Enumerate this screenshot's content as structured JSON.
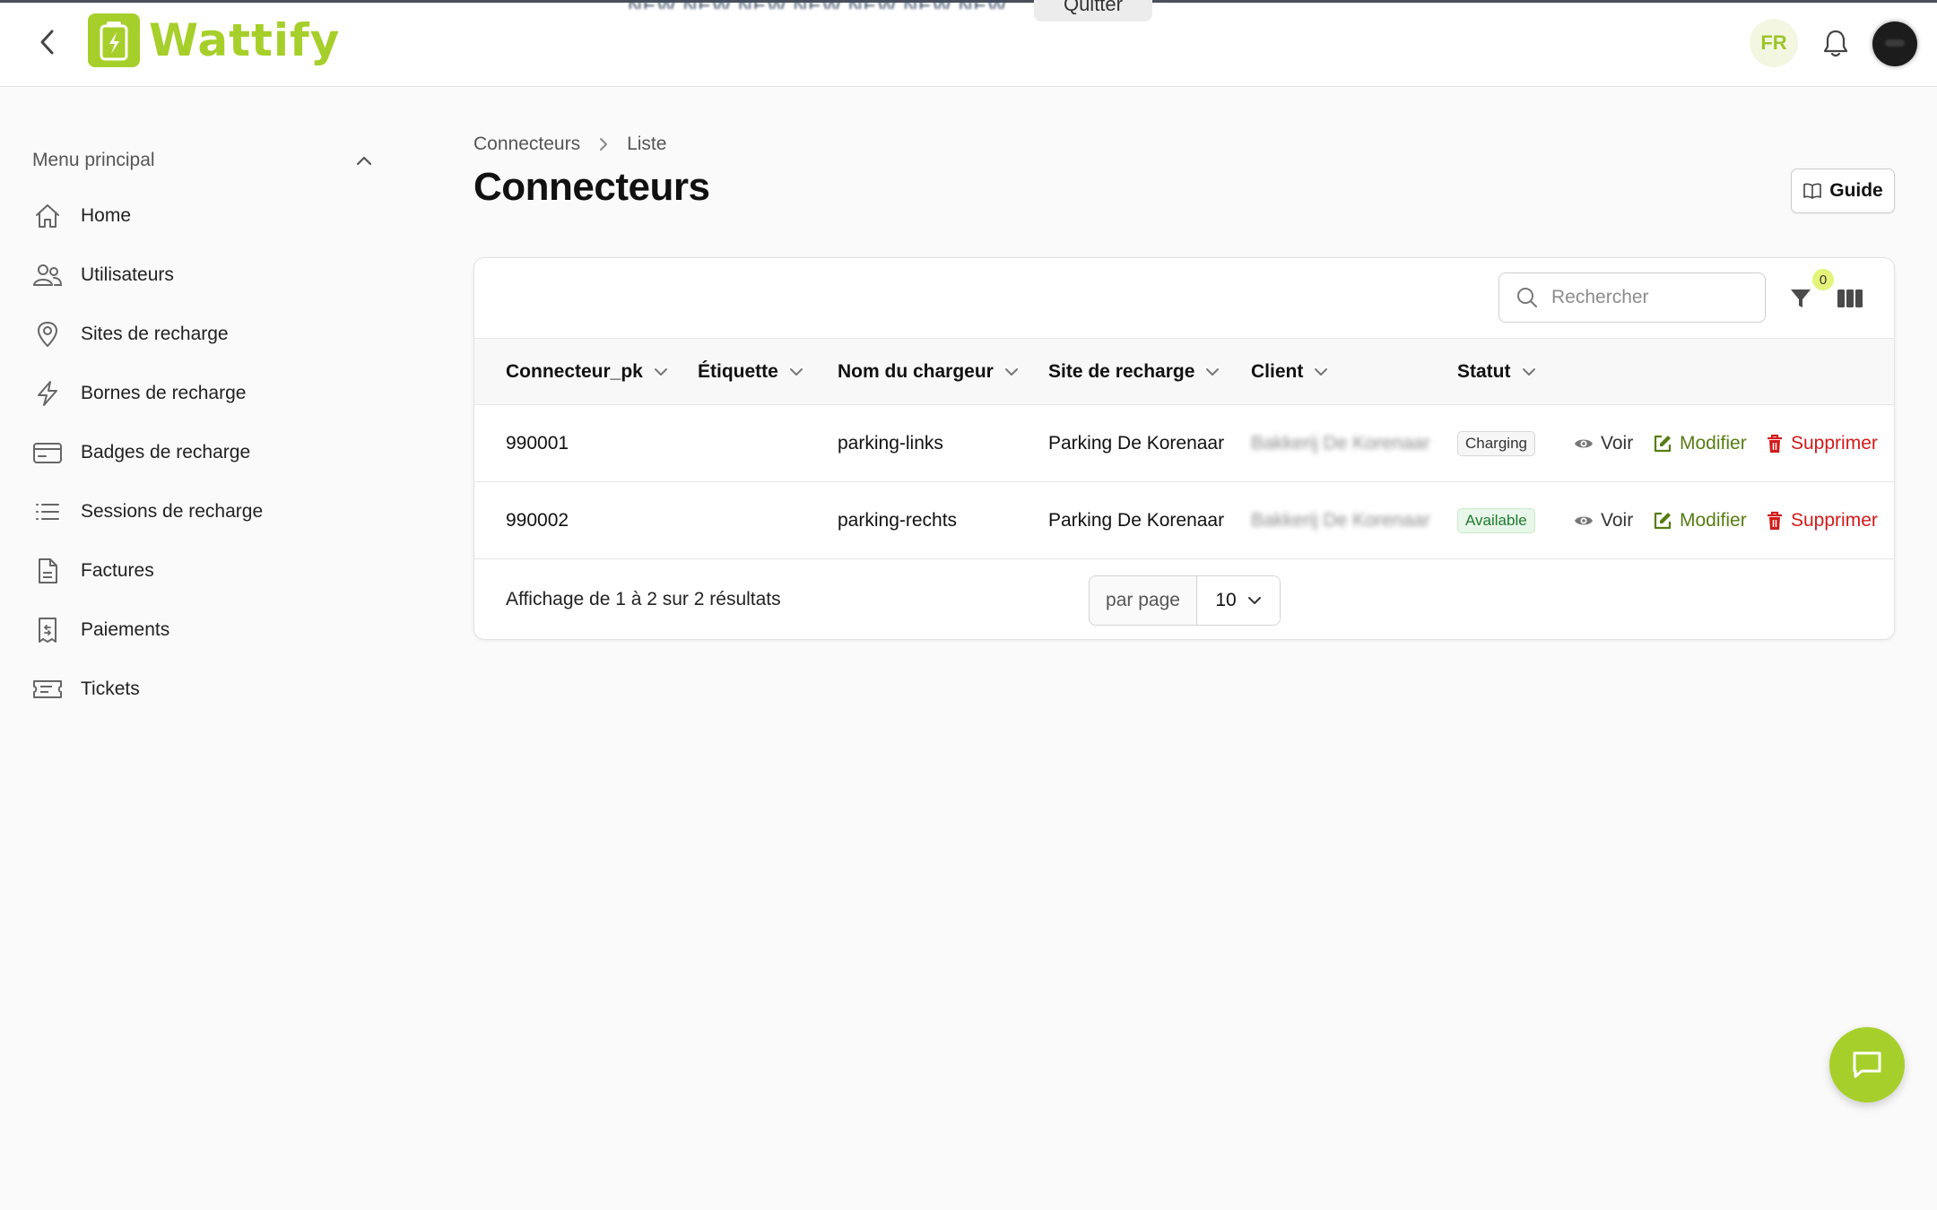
{
  "app": {
    "name": "Wattify",
    "brand_color": "#a6cf2b",
    "impersonation_text": "NEW NEW NEW NEW NEW NEW NEW",
    "quit_label": "Quitter",
    "language": "FR"
  },
  "sidebar": {
    "menu_title": "Menu principal",
    "items": [
      {
        "label": "Home",
        "icon": "home-icon"
      },
      {
        "label": "Utilisateurs",
        "icon": "users-icon"
      },
      {
        "label": "Sites de recharge",
        "icon": "map-pin-icon"
      },
      {
        "label": "Bornes de recharge",
        "icon": "lightning-icon"
      },
      {
        "label": "Badges de recharge",
        "icon": "card-icon"
      },
      {
        "label": "Sessions de recharge",
        "icon": "list-icon"
      },
      {
        "label": "Factures",
        "icon": "document-icon"
      },
      {
        "label": "Paiements",
        "icon": "receipt-icon"
      },
      {
        "label": "Tickets",
        "icon": "ticket-icon"
      }
    ]
  },
  "breadcrumb": [
    "Connecteurs",
    "Liste"
  ],
  "page": {
    "title": "Connecteurs",
    "guide_label": "Guide"
  },
  "toolbar": {
    "search_placeholder": "Rechercher",
    "filter_count": "0"
  },
  "table": {
    "columns": [
      "Connecteur_pk",
      "Étiquette",
      "Nom du chargeur",
      "Site de recharge",
      "Client",
      "Statut"
    ],
    "rows": [
      {
        "pk": "990001",
        "label": "",
        "charger": "parking-links",
        "site": "Parking De Korenaar",
        "client": "Bakkerij De Korenaar",
        "status": "Charging"
      },
      {
        "pk": "990002",
        "label": "",
        "charger": "parking-rechts",
        "site": "Parking De Korenaar",
        "client": "Bakkerij De Korenaar",
        "status": "Available"
      }
    ],
    "actions": {
      "view": "Voir",
      "edit": "Modifier",
      "delete": "Supprimer"
    }
  },
  "footer": {
    "result_text": "Affichage de 1 à 2 sur 2 résultats",
    "per_page_label": "par page",
    "per_page_value": "10"
  },
  "colors": {
    "edit": "#567d12",
    "delete": "#d21a1a",
    "available_bg": "#e8f7e9",
    "filter_badge": "#e4f47a"
  }
}
